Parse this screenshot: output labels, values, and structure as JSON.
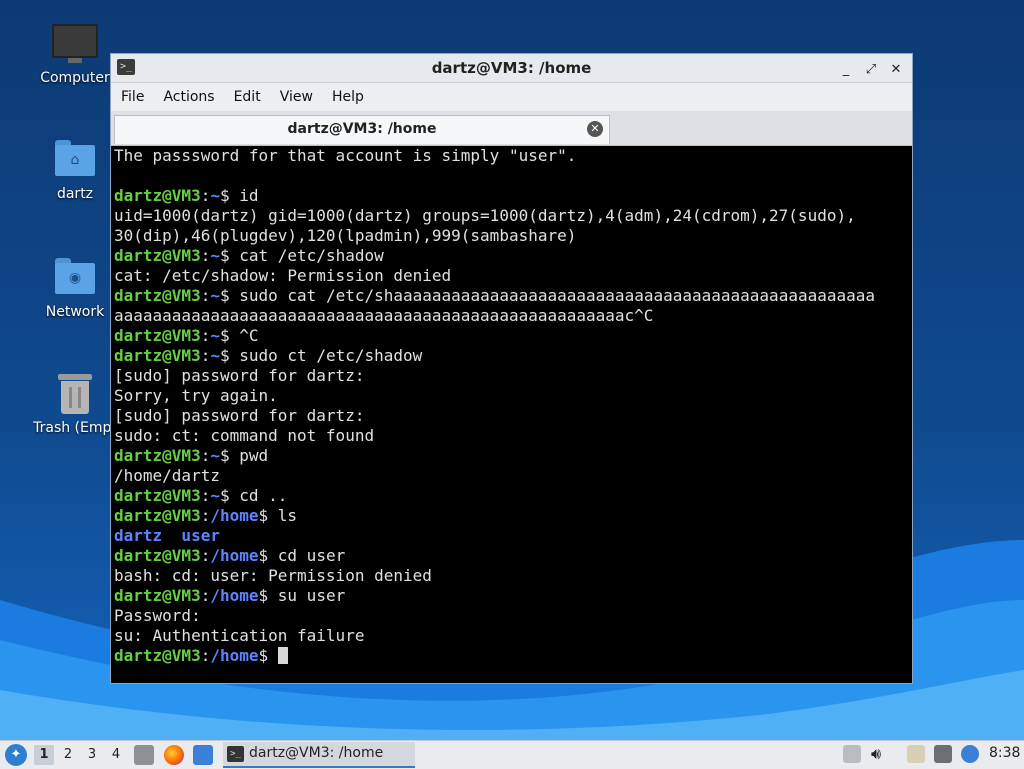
{
  "desktop": {
    "icons": [
      {
        "label": "Computer"
      },
      {
        "label": "dartz"
      },
      {
        "label": "Network"
      },
      {
        "label": "Trash (Empt"
      }
    ]
  },
  "window": {
    "title": "dartz@VM3: /home",
    "controls": {
      "minimize": "_",
      "maximize": "⤢",
      "close": "✕"
    },
    "menu": [
      "File",
      "Actions",
      "Edit",
      "View",
      "Help"
    ],
    "tab_label": "dartz@VM3: /home",
    "prompt_user": "dartz@VM3",
    "terminal_lines": [
      {
        "type": "out",
        "text": "The passsword for that account is simply \"user\"."
      },
      {
        "type": "out",
        "text": ""
      },
      {
        "type": "cmd",
        "path": "~",
        "cmd": "id"
      },
      {
        "type": "out",
        "text": "uid=1000(dartz) gid=1000(dartz) groups=1000(dartz),4(adm),24(cdrom),27(sudo),"
      },
      {
        "type": "out",
        "text": "30(dip),46(plugdev),120(lpadmin),999(sambashare)"
      },
      {
        "type": "cmd",
        "path": "~",
        "cmd": "cat /etc/shadow"
      },
      {
        "type": "out",
        "text": "cat: /etc/shadow: Permission denied"
      },
      {
        "type": "cmd",
        "path": "~",
        "cmd": "sudo cat /etc/shaaaaaaaaaaaaaaaaaaaaaaaaaaaaaaaaaaaaaaaaaaaaaaaaaa"
      },
      {
        "type": "out",
        "text": "aaaaaaaaaaaaaaaaaaaaaaaaaaaaaaaaaaaaaaaaaaaaaaaaaaaaac^C"
      },
      {
        "type": "cmd",
        "path": "~",
        "cmd": "^C"
      },
      {
        "type": "cmd",
        "path": "~",
        "cmd": "sudo ct /etc/shadow"
      },
      {
        "type": "out",
        "text": "[sudo] password for dartz:"
      },
      {
        "type": "out",
        "text": "Sorry, try again."
      },
      {
        "type": "out",
        "text": "[sudo] password for dartz:"
      },
      {
        "type": "out",
        "text": "sudo: ct: command not found"
      },
      {
        "type": "cmd",
        "path": "~",
        "cmd": "pwd"
      },
      {
        "type": "out",
        "text": "/home/dartz"
      },
      {
        "type": "cmd",
        "path": "~",
        "cmd": "cd .."
      },
      {
        "type": "cmd",
        "path": "/home",
        "cmd": "ls"
      },
      {
        "type": "dir",
        "text": "dartz  user"
      },
      {
        "type": "cmd",
        "path": "/home",
        "cmd": "cd user"
      },
      {
        "type": "out",
        "text": "bash: cd: user: Permission denied"
      },
      {
        "type": "cmd",
        "path": "/home",
        "cmd": "su user"
      },
      {
        "type": "out",
        "text": "Password:"
      },
      {
        "type": "out",
        "text": "su: Authentication failure"
      },
      {
        "type": "cmd",
        "path": "/home",
        "cmd": "",
        "cursor": true
      }
    ]
  },
  "taskbar": {
    "workspaces": [
      "1",
      "2",
      "3",
      "4"
    ],
    "active_workspace": "1",
    "task_label": "dartz@VM3: /home",
    "clock": "8:38"
  },
  "colors": {
    "prompt_user": "#66d044",
    "prompt_path": "#5c84ff",
    "terminal_bg": "#000000"
  }
}
